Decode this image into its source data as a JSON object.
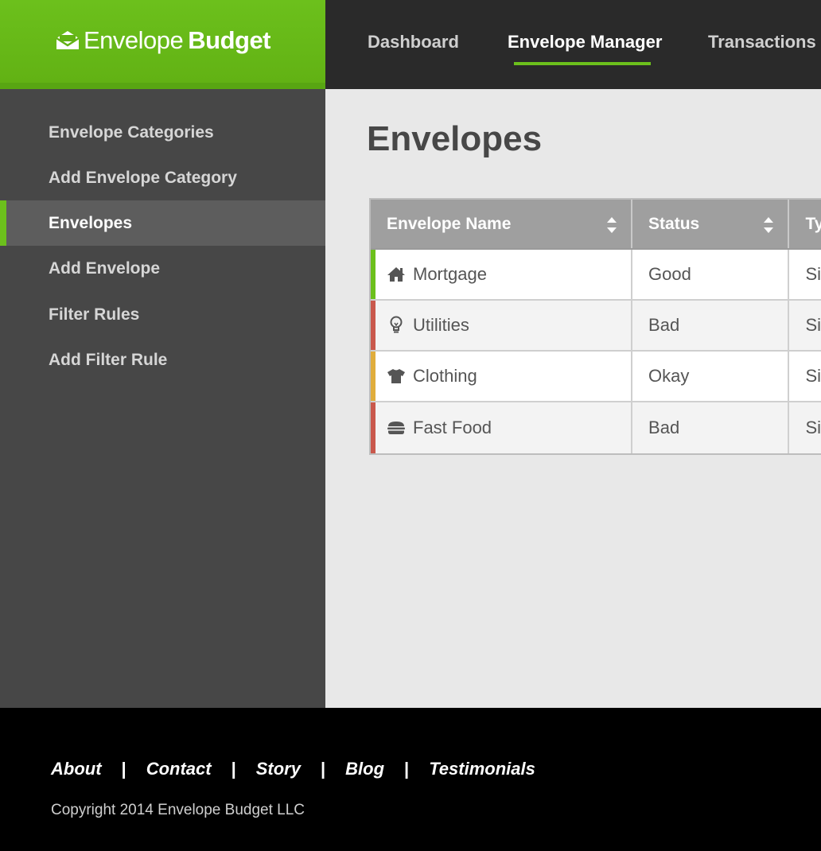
{
  "brand": {
    "light": "Envelope",
    "bold": "Budget",
    "icon": "envelope-icon",
    "color": "#6cc01c"
  },
  "topnav": [
    {
      "label": "Dashboard",
      "active": false
    },
    {
      "label": "Envelope Manager",
      "active": true
    },
    {
      "label": "Transactions",
      "active": false
    }
  ],
  "sidebar": {
    "items": [
      {
        "label": "Envelope Categories"
      },
      {
        "label": "Add Envelope Category"
      },
      {
        "label": "Envelopes",
        "active": true
      },
      {
        "label": "Add Envelope"
      },
      {
        "label": "Filter Rules"
      },
      {
        "label": "Add Filter Rule"
      }
    ]
  },
  "main": {
    "title": "Envelopes",
    "table": {
      "headers": [
        "Envelope Name",
        "Status",
        "Ty"
      ],
      "rows": [
        {
          "name": "Mortgage",
          "icon": "home-icon",
          "status": "Good",
          "type": "Sir",
          "status_color": "#6cc01c"
        },
        {
          "name": "Utilities",
          "icon": "lightbulb-icon",
          "status": "Bad",
          "type": "Sir",
          "status_color": "#c9584c"
        },
        {
          "name": "Clothing",
          "icon": "tshirt-icon",
          "status": "Okay",
          "type": "Sir",
          "status_color": "#e0ad3c"
        },
        {
          "name": "Fast Food",
          "icon": "burger-icon",
          "status": "Bad",
          "type": "Sir",
          "status_color": "#c9584c"
        }
      ]
    }
  },
  "footer": {
    "links": [
      "About",
      "Contact",
      "Story",
      "Blog",
      "Testimonials"
    ],
    "separator": "|",
    "copyright": "Copyright 2014 Envelope Budget LLC"
  }
}
